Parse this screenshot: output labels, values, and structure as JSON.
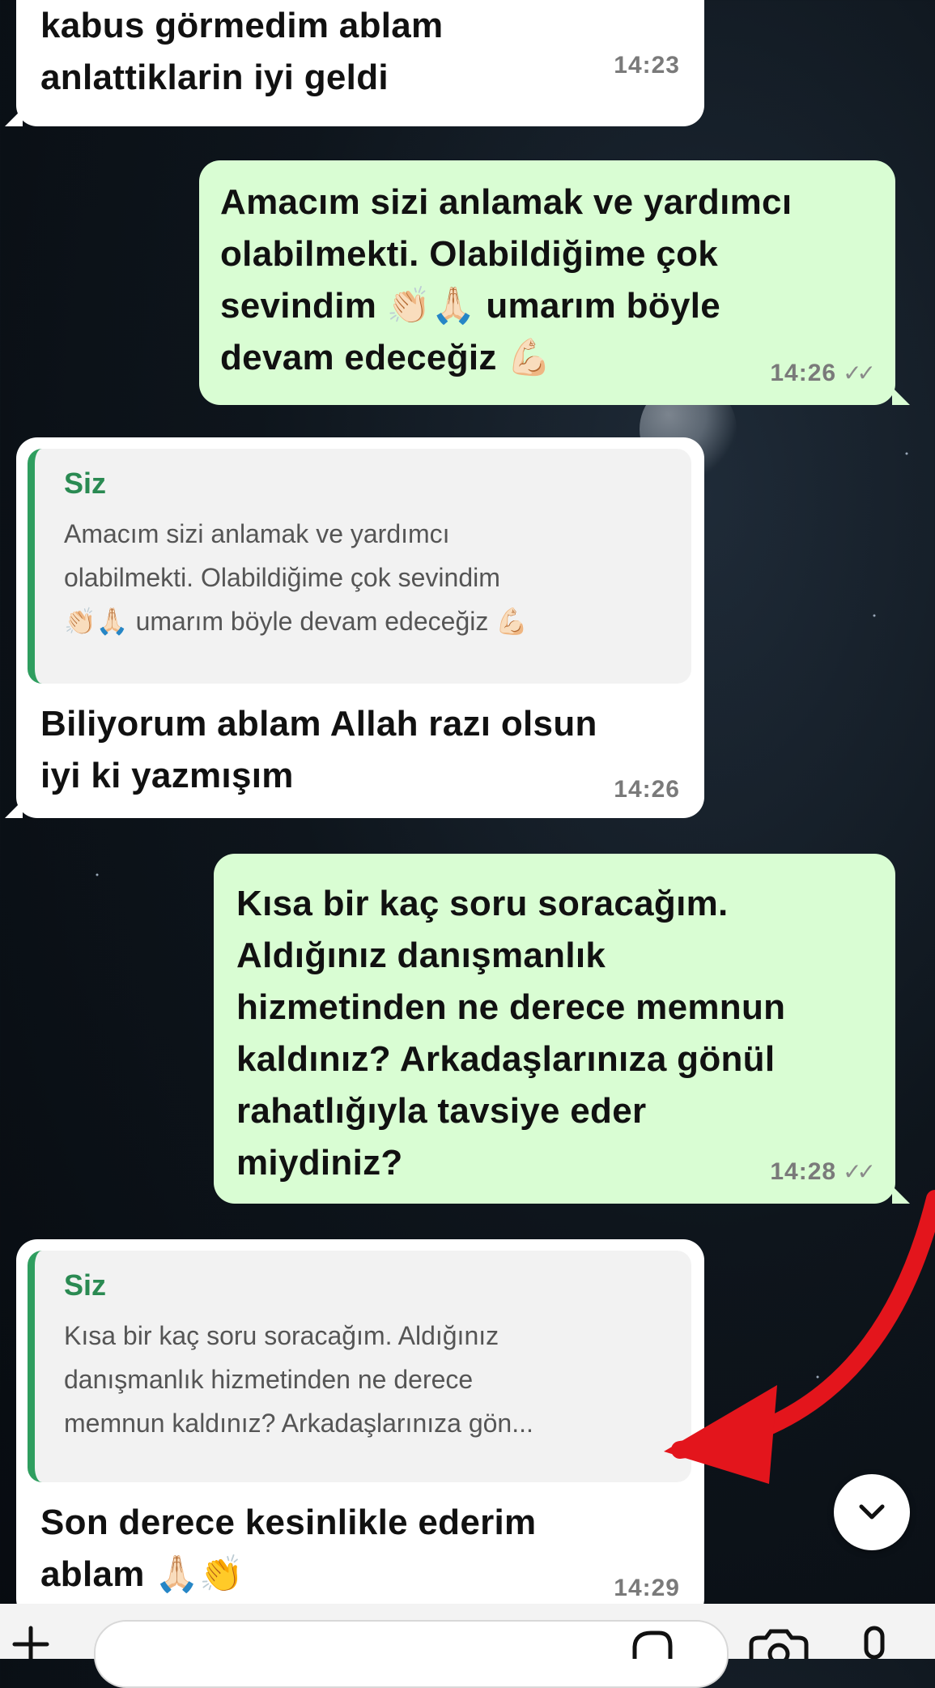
{
  "messages": [
    {
      "type": "incoming",
      "text": "kabus görmedim ablam\nanlattiklarin iyi geldi",
      "time": "14:23"
    },
    {
      "type": "outgoing",
      "text": "Amacım sizi anlamak ve yardımcı\nolabilmekti. Olabildiğime çok\nsevindim 👏🏻🙏🏻 umarım böyle\ndevam edeceğiz 💪🏻",
      "time": "14:26",
      "status": "read"
    },
    {
      "type": "incoming",
      "quote_author": "Siz",
      "quote_text": "Amacım sizi anlamak ve yardımcı\nolabilmekti. Olabildiğime çok sevindim\n👏🏻🙏🏻 umarım böyle devam edeceğiz 💪🏻",
      "text": "Biliyorum ablam Allah razı olsun\niyi ki yazmışım",
      "time": "14:26"
    },
    {
      "type": "outgoing",
      "text": "Kısa bir kaç soru soracağım.\nAldığınız danışmanlık\nhizmetinden ne derece memnun\nkaldınız? Arkadaşlarınıza gönül\nrahatlığıyla tavsiye eder\nmiydiniz?",
      "time": "14:28",
      "status": "read"
    },
    {
      "type": "incoming",
      "quote_author": "Siz",
      "quote_text": "Kısa bir kaç soru soracağım. Aldığınız\ndanışmanlık hizmetinden ne derece\nmemnun kaldınız? Arkadaşlarınıza gön...",
      "text": "Son derece kesinlikle ederim\nablam 🙏🏻👏",
      "time": "14:29"
    }
  ],
  "ticks_glyph": "✓✓",
  "scroll_down_icon": "chevron-down-icon",
  "composer": {
    "attach_icon": "plus-icon",
    "sticker_icon": "sticker-icon",
    "camera_icon": "camera-icon",
    "mic_icon": "mic-icon"
  },
  "colors": {
    "incoming": "#ffffff",
    "outgoing": "#d9fdd3",
    "quote_bar": "#2f9e5f",
    "annotation_arrow": "#e3151c"
  }
}
